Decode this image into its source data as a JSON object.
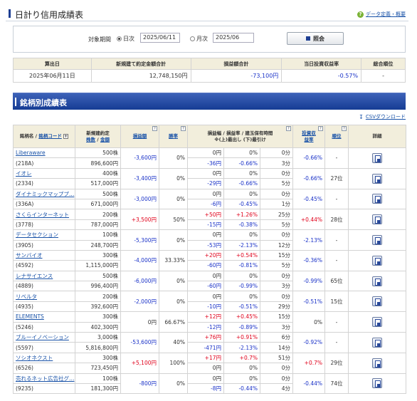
{
  "header": {
    "title": "日計り信用成績表",
    "help_link": "データ定義・概要"
  },
  "filter": {
    "period_label": "対象期間",
    "daily_label": "日次",
    "daily_value": "2025/06/11",
    "monthly_label": "月次",
    "monthly_value": "2025/06",
    "show_button": "照会"
  },
  "summary": {
    "headers": [
      "算出日",
      "新規建て約定金額合計",
      "損益額合計",
      "当日投資収益率",
      "総合順位"
    ],
    "values": [
      "2025年06月11日",
      "12,748,150円",
      "-73,100円",
      "-0.57%",
      "-"
    ]
  },
  "section": {
    "title": "銘柄別成績表",
    "csv_link": "CSVダウンロード"
  },
  "grid": {
    "headers": {
      "name": "銘柄名",
      "sep": " / ",
      "code": "銘柄コード",
      "sort_symbol": "+",
      "volume": "新規建約定",
      "shares": "株数",
      "amount": "金額",
      "pnl": "損益額",
      "win_rate": "勝率",
      "detail_l1": "損益幅 / 損益率 / 建玉保有時間",
      "detail_l2": "※(上)最出し (下)最引け",
      "roi": "投資収益率",
      "rank": "順位",
      "detail": "詳細",
      "q": "?"
    },
    "rows": [
      {
        "name": "Liberaware",
        "code": "(218A)",
        "shares": "500株",
        "amount": "896,600円",
        "pnl": "-3,600円",
        "win_rate": "0%",
        "top_range": "0円",
        "top_rate": "0%",
        "top_time": "0分",
        "bot_range": "-36円",
        "bot_rate": "-0.66%",
        "bot_time": "3分",
        "roi": "-0.66%",
        "rank": "-"
      },
      {
        "name": "イオレ",
        "code": "(2334)",
        "shares": "400株",
        "amount": "517,000円",
        "pnl": "-3,400円",
        "win_rate": "0%",
        "top_range": "0円",
        "top_rate": "0%",
        "top_time": "0分",
        "bot_range": "-29円",
        "bot_rate": "-0.66%",
        "bot_time": "5分",
        "roi": "-0.66%",
        "rank": "27位"
      },
      {
        "name": "ダイナミックマッププ…",
        "code": "(336A)",
        "shares": "500株",
        "amount": "671,000円",
        "pnl": "-3,000円",
        "win_rate": "0%",
        "top_range": "0円",
        "top_rate": "0%",
        "top_time": "0分",
        "bot_range": "-6円",
        "bot_rate": "-0.45%",
        "bot_time": "1分",
        "roi": "-0.45%",
        "rank": "-"
      },
      {
        "name": "さくらインターネット",
        "code": "(3778)",
        "shares": "200株",
        "amount": "787,000円",
        "pnl": "+3,500円",
        "win_rate": "50%",
        "top_range": "+50円",
        "top_rate": "+1.26%",
        "top_time": "25分",
        "bot_range": "-15円",
        "bot_rate": "-0.38%",
        "bot_time": "5分",
        "roi": "+0.44%",
        "rank": "28位"
      },
      {
        "name": "データセクション",
        "code": "(3905)",
        "shares": "100株",
        "amount": "248,700円",
        "pnl": "-5,300円",
        "win_rate": "0%",
        "top_range": "0円",
        "top_rate": "0%",
        "top_time": "0分",
        "bot_range": "-53円",
        "bot_rate": "-2.13%",
        "bot_time": "12分",
        "roi": "-2.13%",
        "rank": "-"
      },
      {
        "name": "サンバイオ",
        "code": "(4592)",
        "shares": "300株",
        "amount": "1,115,000円",
        "pnl": "-4,000円",
        "win_rate": "33.33%",
        "top_range": "+20円",
        "top_rate": "+0.54%",
        "top_time": "15分",
        "bot_range": "-60円",
        "bot_rate": "-0.81%",
        "bot_time": "5分",
        "roi": "-0.36%",
        "rank": "-"
      },
      {
        "name": "レナサイエンス",
        "code": "(4889)",
        "shares": "500株",
        "amount": "996,400円",
        "pnl": "-6,000円",
        "win_rate": "0%",
        "top_range": "0円",
        "top_rate": "0%",
        "top_time": "0分",
        "bot_range": "-60円",
        "bot_rate": "-0.99%",
        "bot_time": "3分",
        "roi": "-0.99%",
        "rank": "65位"
      },
      {
        "name": "リベルタ",
        "code": "(4935)",
        "shares": "200株",
        "amount": "392,600円",
        "pnl": "-2,000円",
        "win_rate": "0%",
        "top_range": "0円",
        "top_rate": "0%",
        "top_time": "0分",
        "bot_range": "-10円",
        "bot_rate": "-0.51%",
        "bot_time": "29分",
        "roi": "-0.51%",
        "rank": "15位"
      },
      {
        "name": "ELEMENTS",
        "code": "(5246)",
        "shares": "300株",
        "amount": "402,300円",
        "pnl": "0円",
        "win_rate": "66.67%",
        "top_range": "+12円",
        "top_rate": "+0.45%",
        "top_time": "15分",
        "bot_range": "-12円",
        "bot_rate": "-0.89%",
        "bot_time": "3分",
        "roi": "0%",
        "rank": "-"
      },
      {
        "name": "ブルーイノベーション",
        "code": "(5597)",
        "shares": "3,000株",
        "amount": "5,816,800円",
        "pnl": "-53,600円",
        "win_rate": "40%",
        "top_range": "+76円",
        "top_rate": "+0.91%",
        "top_time": "6分",
        "bot_range": "-471円",
        "bot_rate": "-2.13%",
        "bot_time": "14分",
        "roi": "-0.92%",
        "rank": "-"
      },
      {
        "name": "ソシオネクスト",
        "code": "(6526)",
        "shares": "300株",
        "amount": "723,450円",
        "pnl": "+5,100円",
        "win_rate": "100%",
        "top_range": "+17円",
        "top_rate": "+0.7%",
        "top_time": "51分",
        "bot_range": "0円",
        "bot_rate": "0%",
        "bot_time": "0分",
        "roi": "+0.7%",
        "rank": "29位"
      },
      {
        "name": "売れるネット広告社グ…",
        "code": "(9235)",
        "shares": "100株",
        "amount": "181,300円",
        "pnl": "-800円",
        "win_rate": "0%",
        "top_range": "0円",
        "top_rate": "0%",
        "top_time": "0分",
        "bot_range": "-8円",
        "bot_rate": "-0.44%",
        "bot_time": "4分",
        "roi": "-0.44%",
        "rank": "74位"
      }
    ]
  },
  "colors": {
    "positive": "#e0001a",
    "negative": "#1a32c8",
    "band": "#1e3f93",
    "header_bg": "#f2eedc"
  },
  "icons": {
    "help": "question-circle-icon",
    "show": "search-square-icon",
    "csv": "download-arrow-icon",
    "detail": "document-detail-icon"
  }
}
